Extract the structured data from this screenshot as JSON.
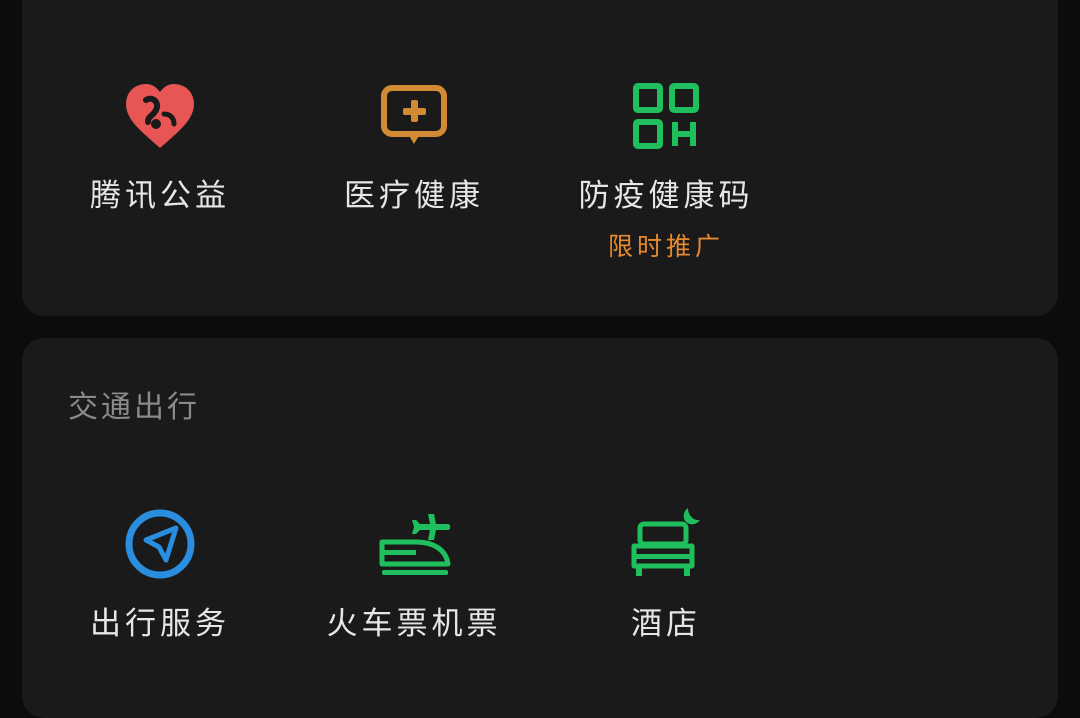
{
  "services_top": {
    "items": [
      {
        "label": "腾讯公益",
        "icon": "heart-charity-icon",
        "color": "#e85555"
      },
      {
        "label": "医疗健康",
        "icon": "medical-cross-chat-icon",
        "color": "#d38b33"
      },
      {
        "label": "防疫健康码",
        "sub": "限时推广",
        "icon": "qr-code-icon",
        "color": "#1fbf5e"
      }
    ]
  },
  "transport": {
    "title": "交通出行",
    "items": [
      {
        "label": "出行服务",
        "icon": "navigation-compass-icon",
        "color": "#2a8ee0"
      },
      {
        "label": "火车票机票",
        "icon": "train-plane-icon",
        "color": "#1fbf5e"
      },
      {
        "label": "酒店",
        "icon": "hotel-bed-icon",
        "color": "#1fbf5e"
      }
    ]
  },
  "colors": {
    "background": "#0c0c0c",
    "card": "#1a1a1a",
    "label": "#e6e6e6",
    "section_title": "#8a8a8a",
    "promo": "#e7892f"
  }
}
